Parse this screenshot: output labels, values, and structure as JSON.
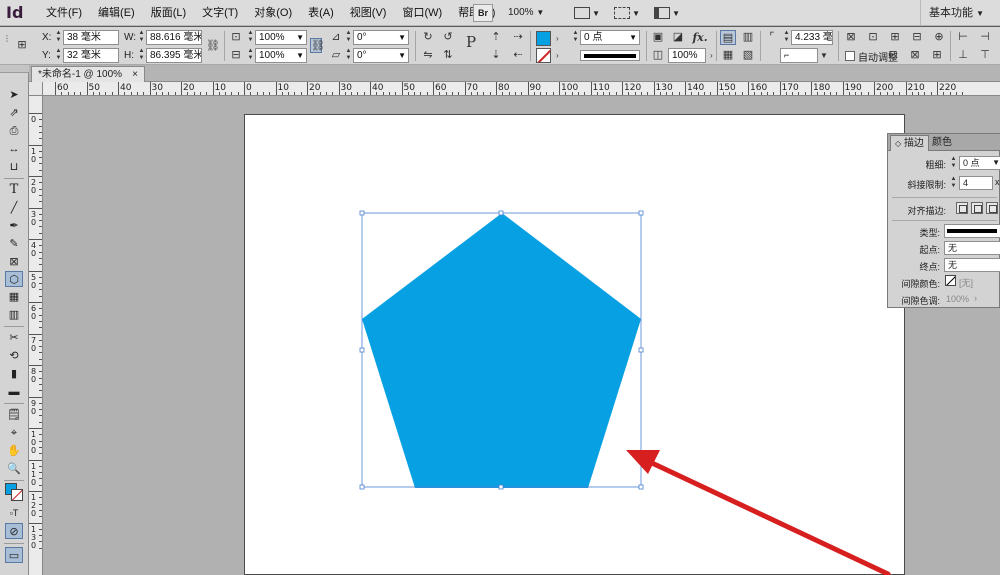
{
  "app": {
    "logo": "Id"
  },
  "menu": {
    "items": [
      "文件(F)",
      "编辑(E)",
      "版面(L)",
      "文字(T)",
      "对象(O)",
      "表(A)",
      "视图(V)",
      "窗口(W)",
      "帮助(H)"
    ],
    "bridge": "Br",
    "zoom": "100%",
    "workspace": "基本功能"
  },
  "control": {
    "x_label": "X:",
    "x": "38 毫米",
    "y_label": "Y:",
    "y": "32 毫米",
    "w_label": "W:",
    "w": "88.616 毫米",
    "h_label": "H:",
    "h": "86.395 毫米",
    "scale_x": "100%",
    "scale_y": "100%",
    "rotate": "0°",
    "shear": "0°",
    "stroke_weight": "0 点",
    "opacity": "100%",
    "corner_size": "4.233 毫",
    "auto_fit_label": "自动调整",
    "fx_label": "fx."
  },
  "colors": {
    "fill": "#07a0e3",
    "arrow": "#d71f1f",
    "selection": "#4a7fd0"
  },
  "tab": {
    "title": "*未命名-1 @ 100%",
    "close": "×"
  },
  "ruler": {
    "h_labels": [
      "60",
      "50",
      "40",
      "30",
      "20",
      "10",
      "0",
      "10",
      "20",
      "30",
      "40",
      "50",
      "60",
      "70",
      "80",
      "90",
      "100",
      "110",
      "120",
      "130",
      "140",
      "150",
      "160",
      "170",
      "180",
      "190",
      "200",
      "210",
      "220"
    ],
    "v_labels": [
      "0",
      "1 0",
      "2 0",
      "3 0",
      "4 0",
      "5 0",
      "6 0",
      "7 0",
      "8 0",
      "9 0",
      "1 0 0",
      "1 1 0",
      "1 2 0",
      "1 3 0"
    ]
  },
  "stroke_panel": {
    "tab_stroke": "描边",
    "tab_color": "颜色",
    "weight_label": "粗细:",
    "weight": "0 点",
    "miter_label": "斜接限制:",
    "miter": "4",
    "align_label": "对齐描边:",
    "type_label": "类型:",
    "start_label": "起点:",
    "start": "无",
    "end_label": "终点:",
    "end": "无",
    "gap_color_label": "间隙颜色:",
    "gap_color": "[无]",
    "gap_tint_label": "间隙色调:",
    "gap_tint": "100%"
  }
}
